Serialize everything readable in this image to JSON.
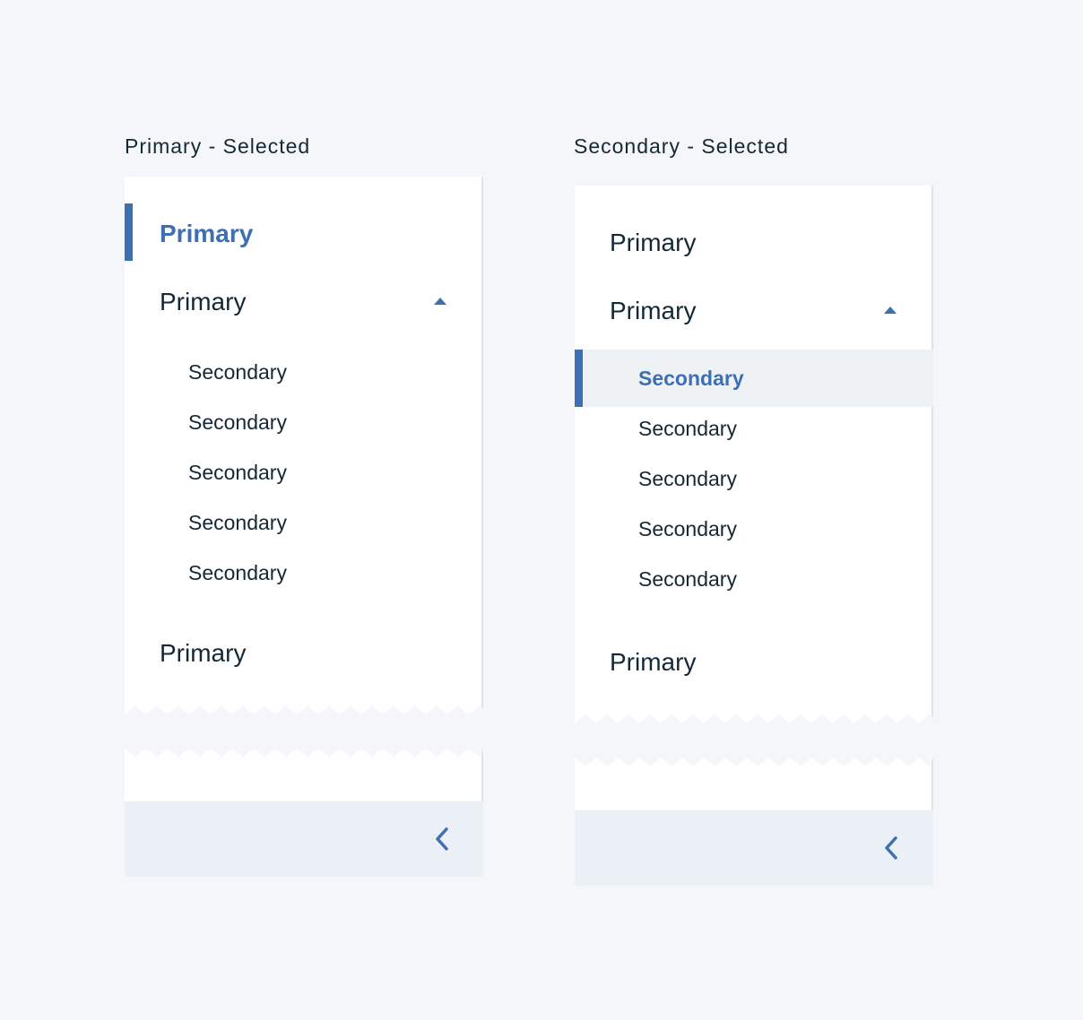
{
  "panels": [
    {
      "title": "Primary - Selected",
      "items": [
        {
          "type": "primary",
          "label": "Primary",
          "selected": true
        },
        {
          "type": "primary",
          "label": "Primary",
          "expanded": true
        },
        {
          "type": "secondary",
          "label": "Secondary"
        },
        {
          "type": "secondary",
          "label": "Secondary"
        },
        {
          "type": "secondary",
          "label": "Secondary"
        },
        {
          "type": "secondary",
          "label": "Secondary"
        },
        {
          "type": "secondary",
          "label": "Secondary"
        },
        {
          "type": "primary",
          "label": "Primary"
        }
      ],
      "footer_icon": "chevron-left-icon"
    },
    {
      "title": "Secondary - Selected",
      "items": [
        {
          "type": "primary",
          "label": "Primary"
        },
        {
          "type": "primary",
          "label": "Primary",
          "expanded": true
        },
        {
          "type": "secondary",
          "label": "Secondary",
          "selected": true
        },
        {
          "type": "secondary",
          "label": "Secondary"
        },
        {
          "type": "secondary",
          "label": "Secondary"
        },
        {
          "type": "secondary",
          "label": "Secondary"
        },
        {
          "type": "secondary",
          "label": "Secondary"
        },
        {
          "type": "primary",
          "label": "Primary"
        }
      ],
      "footer_icon": "chevron-left-icon"
    }
  ],
  "colors": {
    "background": "#f4f6fa",
    "panel": "#ffffff",
    "accent": "#3d70b2",
    "text": "#152935",
    "selected_row": "#eff2f5",
    "footer": "#ebeff6",
    "border": "#dfe3e6"
  }
}
